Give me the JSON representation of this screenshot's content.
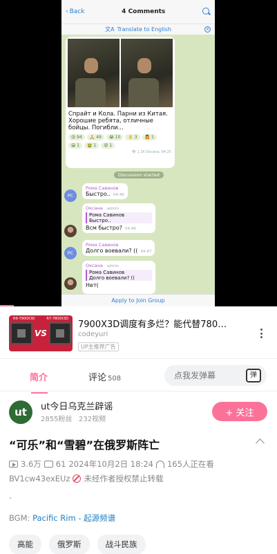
{
  "telegram": {
    "back_label": "Back",
    "title": "4 Comments",
    "translate_label": "Translate to English",
    "post_text": "Спрайт и Кола. Парни из Китая. Хорошие ребята, отличные бойцы. Погибли...",
    "reactions": [
      "😢 94",
      "🙏 49",
      "😭 10",
      "👌 3",
      "🤷 1",
      "😁 1",
      "🤮 1",
      "😡 1"
    ],
    "post_footer": "👁 1.1K Оксана, 04:25",
    "system_message": "Discussion started",
    "messages": [
      {
        "name": "Рома Савинов",
        "text": "Быстро..",
        "time": "04:46",
        "avatar": "PC"
      },
      {
        "name": "Оксана",
        "role": "admin",
        "quote_name": "Рома Савинов",
        "quote_text": "Быстро..",
        "text": "Всм быстро?",
        "time": "04:46"
      },
      {
        "name": "Рома Савинов",
        "text": "Долго воевали? ((",
        "time": "04:47",
        "avatar": "PC"
      },
      {
        "name": "Оксана",
        "role": "admin",
        "quote_name": "Рома Савинов",
        "quote_text": "Долго воевали? ((",
        "text": "Нет("
      }
    ],
    "join_label": "Apply to Join Group"
  },
  "ad": {
    "title": "7900X3D调度有多烂？能代替780…",
    "author": "codeyuri",
    "tag": "UP主推荐广告",
    "thumb_left_label": "R9-7900X3D",
    "thumb_right_label": "R7-7800X3D",
    "thumb_vs": "VS"
  },
  "tabs": {
    "intro": "简介",
    "comments": "评论",
    "comments_count": "508",
    "danmaku_placeholder": "点我发弹幕",
    "danmaku_icon": "弹"
  },
  "uploader": {
    "avatar_text": "ut",
    "name": "ut今日乌克兰辟谣",
    "fans": "2855粉丝",
    "videos": "232视频",
    "follow_label": "+ 关注"
  },
  "video": {
    "title": "“可乐”和“雪碧”在俄罗斯阵亡",
    "plays": "3.6万",
    "danmaku_count": "61",
    "date": "2024年10月2日 18:24",
    "watching": "165人正在看",
    "bvid": "BV1cw43exEUz",
    "copyright": "未经作者授权禁止转载",
    "description": "-",
    "bgm_label": "BGM:",
    "bgm_song": "Pacific Rim - 起源频谱",
    "tags": [
      "高能",
      "俄罗斯",
      "战斗民族"
    ]
  },
  "colors": {
    "accent": "#fb7299",
    "telegram_blue": "#2b7fd6"
  },
  "playback_progress_percent": 5
}
